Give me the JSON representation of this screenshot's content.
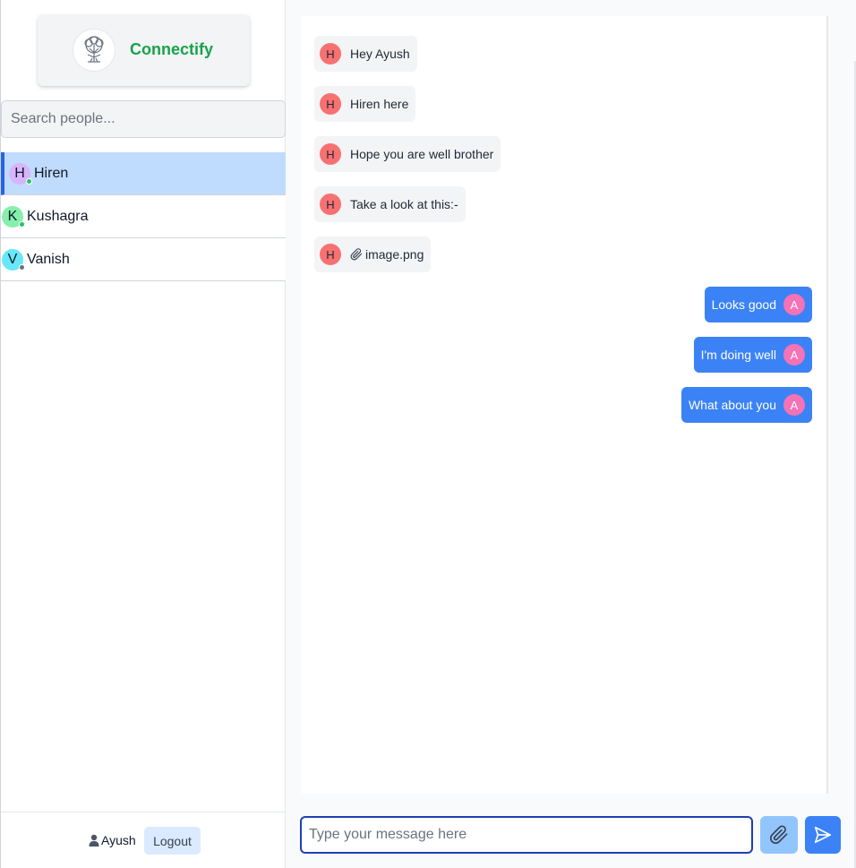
{
  "brand": {
    "name": "Connectify",
    "logo_icon": "tree-logo-icon",
    "color": "#16a34a"
  },
  "search": {
    "placeholder": "Search people..."
  },
  "users": [
    {
      "initial": "H",
      "name": "Hiren",
      "avatar_color": "#d8b4fe",
      "status": "online",
      "status_color": "#22c55e",
      "active": true
    },
    {
      "initial": "K",
      "name": "Kushagra",
      "avatar_color": "#86efac",
      "status": "online",
      "status_color": "#22c55e",
      "active": false
    },
    {
      "initial": "V",
      "name": "Vanish",
      "avatar_color": "#67e8f9",
      "status": "offline",
      "status_color": "#6b7280",
      "active": false
    }
  ],
  "footer": {
    "user_icon": "user-icon",
    "username": "Ayush",
    "logout_label": "Logout"
  },
  "messages": [
    {
      "direction": "in",
      "initial": "H",
      "text": "Hey Ayush"
    },
    {
      "direction": "in",
      "initial": "H",
      "text": "Hiren here"
    },
    {
      "direction": "in",
      "initial": "H",
      "text": "Hope you are well brother"
    },
    {
      "direction": "in",
      "initial": "H",
      "text": "Take a look at this:-"
    },
    {
      "direction": "in",
      "initial": "H",
      "text": "image.png",
      "attachment": true,
      "icon": "paperclip-icon"
    },
    {
      "direction": "out",
      "initial": "A",
      "text": "Looks good"
    },
    {
      "direction": "out",
      "initial": "A",
      "text": "I'm doing well"
    },
    {
      "direction": "out",
      "initial": "A",
      "text": "What about you"
    }
  ],
  "composer": {
    "placeholder": "Type your message here",
    "value": "",
    "attach_icon": "paperclip-icon",
    "send_icon": "send-icon"
  },
  "colors": {
    "accent": "#3b82f6",
    "active_row": "#bfdbfe",
    "incoming_bubble": "#f3f4f6"
  }
}
